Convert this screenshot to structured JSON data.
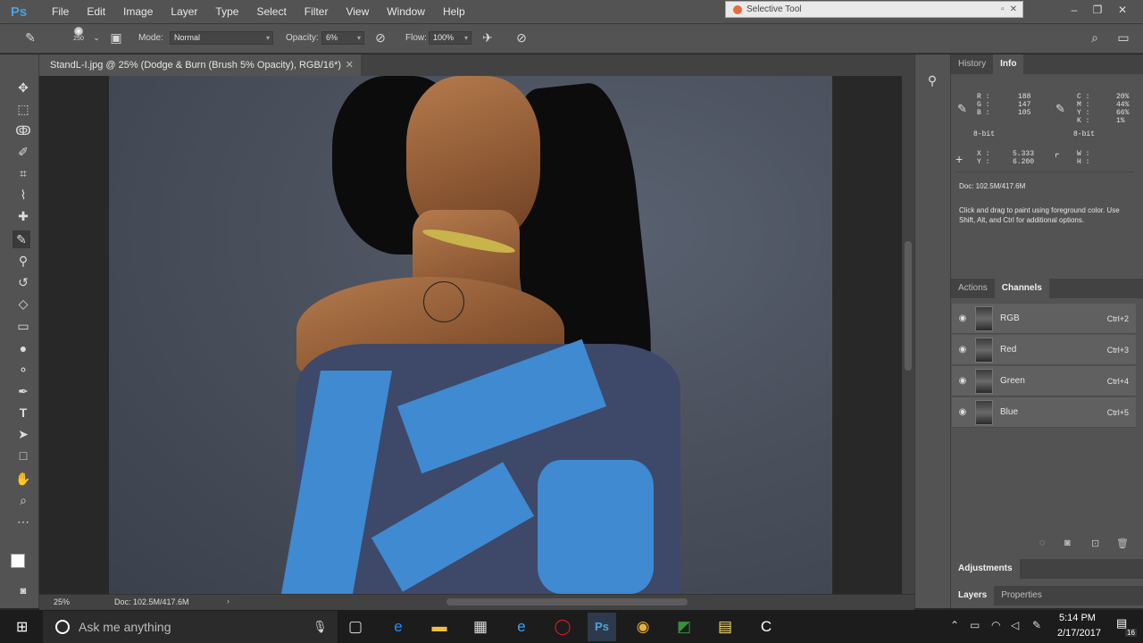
{
  "app": {
    "logo": "Ps",
    "menu": [
      "File",
      "Edit",
      "Image",
      "Layer",
      "Type",
      "Select",
      "Filter",
      "View",
      "Window",
      "Help"
    ]
  },
  "popup": {
    "title": "Selective Tool"
  },
  "options": {
    "brush_size": "250",
    "mode_label": "Mode:",
    "mode_value": "Normal",
    "opacity_label": "Opacity:",
    "opacity_value": "6%",
    "flow_label": "Flow:",
    "flow_value": "100%"
  },
  "document": {
    "tab_title": "StandL-I.jpg @ 25% (Dodge & Burn (Brush 5% Opacity), RGB/16*)",
    "zoom": "25%",
    "doc_size": "Doc: 102.5M/417.6M"
  },
  "panels": {
    "top_tabs": [
      "History",
      "Info"
    ],
    "info": {
      "rgb_labels": [
        "R :",
        "G :",
        "B :"
      ],
      "rgb_values": [
        "188",
        "147",
        "105"
      ],
      "cmyk_labels": [
        "C :",
        "M :",
        "Y :",
        "K :"
      ],
      "cmyk_values": [
        "20%",
        "44%",
        "66%",
        "1%"
      ],
      "bit_left": "8-bit",
      "bit_right": "8-bit",
      "xy_labels": [
        "X :",
        "Y :"
      ],
      "xy_values": [
        "5.333",
        "6.200"
      ],
      "wh_labels": [
        "W :",
        "H :"
      ],
      "doc": "Doc: 102.5M/417.6M",
      "hint": "Click and drag to paint using foreground color. Use Shift, Alt, and Ctrl for additional options."
    },
    "mid_tabs": [
      "Actions",
      "Channels"
    ],
    "channels": [
      {
        "name": "RGB",
        "key": "Ctrl+2"
      },
      {
        "name": "Red",
        "key": "Ctrl+3"
      },
      {
        "name": "Green",
        "key": "Ctrl+4"
      },
      {
        "name": "Blue",
        "key": "Ctrl+5"
      }
    ],
    "adjustments": "Adjustments",
    "bottom_tabs": [
      "Layers",
      "Properties"
    ]
  },
  "taskbar": {
    "search_placeholder": "Ask me anything",
    "time": "5:14 PM",
    "date": "2/17/2017",
    "notif_count": "16"
  }
}
